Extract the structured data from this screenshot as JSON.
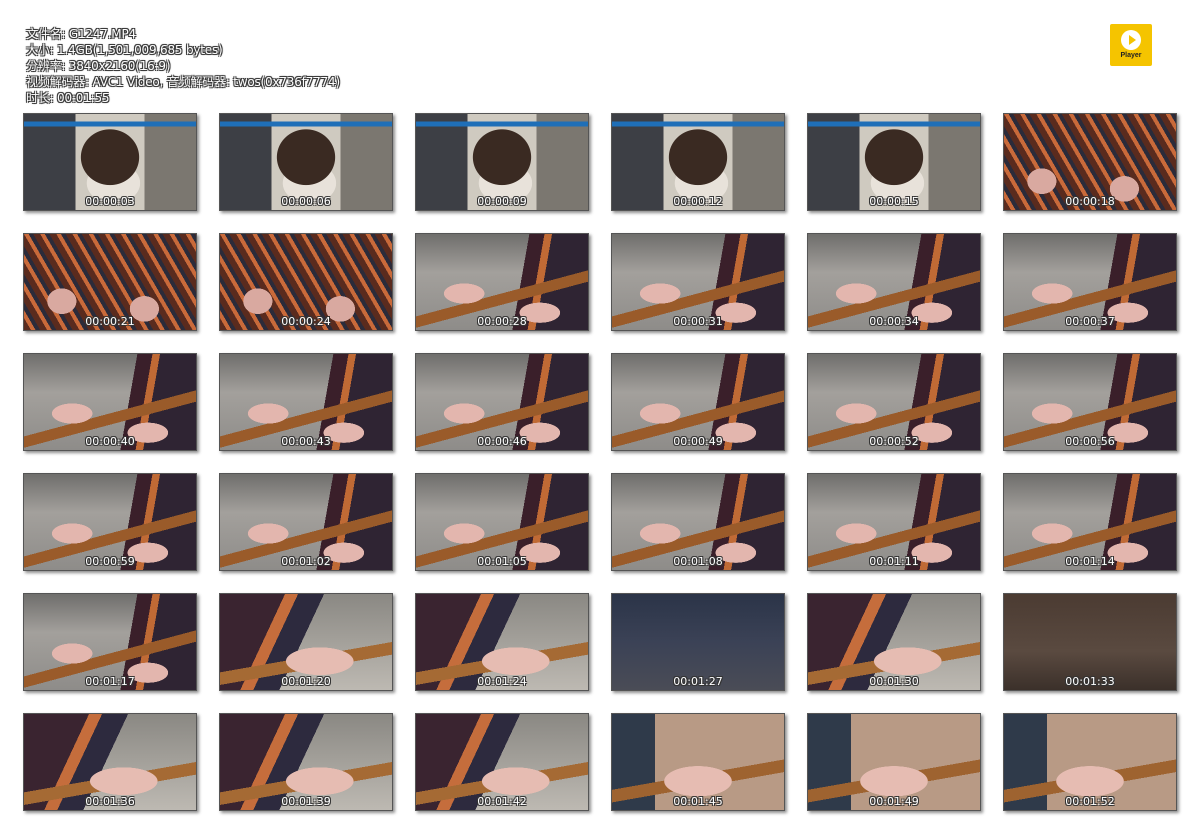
{
  "header": {
    "filename": "文件名: G1247.MP4",
    "size": "大小: 1.4GB(1,501,009,685 bytes)",
    "resolution": "分辨率: 3840x2160(16:9)",
    "codec": "视频解码器: AVC1 Video, 音频解码器: twos(0x736f7774)",
    "duration": "时长: 00:01:55"
  },
  "logo": {
    "text": "Player",
    "color": "#f5c400",
    "icon": "play-icon"
  },
  "thumbnails": [
    {
      "time": "00:00:03",
      "scene": "station"
    },
    {
      "time": "00:00:06",
      "scene": "station"
    },
    {
      "time": "00:00:09",
      "scene": "station"
    },
    {
      "time": "00:00:12",
      "scene": "station"
    },
    {
      "time": "00:00:15",
      "scene": "station"
    },
    {
      "time": "00:00:18",
      "scene": "legs"
    },
    {
      "time": "00:00:21",
      "scene": "legs"
    },
    {
      "time": "00:00:24",
      "scene": "legs"
    },
    {
      "time": "00:00:28",
      "scene": "feet"
    },
    {
      "time": "00:00:31",
      "scene": "feet"
    },
    {
      "time": "00:00:34",
      "scene": "feet"
    },
    {
      "time": "00:00:37",
      "scene": "feet"
    },
    {
      "time": "00:00:40",
      "scene": "feet"
    },
    {
      "time": "00:00:43",
      "scene": "feet"
    },
    {
      "time": "00:00:46",
      "scene": "feet"
    },
    {
      "time": "00:00:49",
      "scene": "feet"
    },
    {
      "time": "00:00:52",
      "scene": "feet"
    },
    {
      "time": "00:00:56",
      "scene": "feet"
    },
    {
      "time": "00:00:59",
      "scene": "feet"
    },
    {
      "time": "00:01:02",
      "scene": "feet"
    },
    {
      "time": "00:01:05",
      "scene": "feet"
    },
    {
      "time": "00:01:08",
      "scene": "feet"
    },
    {
      "time": "00:01:11",
      "scene": "feet"
    },
    {
      "time": "00:01:14",
      "scene": "feet"
    },
    {
      "time": "00:01:17",
      "scene": "feet"
    },
    {
      "time": "00:01:20",
      "scene": "close"
    },
    {
      "time": "00:01:24",
      "scene": "close"
    },
    {
      "time": "00:01:27",
      "scene": "dark"
    },
    {
      "time": "00:01:30",
      "scene": "close"
    },
    {
      "time": "00:01:33",
      "scene": "brown"
    },
    {
      "time": "00:01:36",
      "scene": "close"
    },
    {
      "time": "00:01:39",
      "scene": "close"
    },
    {
      "time": "00:01:42",
      "scene": "close"
    },
    {
      "time": "00:01:45",
      "scene": "tan"
    },
    {
      "time": "00:01:49",
      "scene": "tan"
    },
    {
      "time": "00:01:52",
      "scene": "tan"
    }
  ]
}
